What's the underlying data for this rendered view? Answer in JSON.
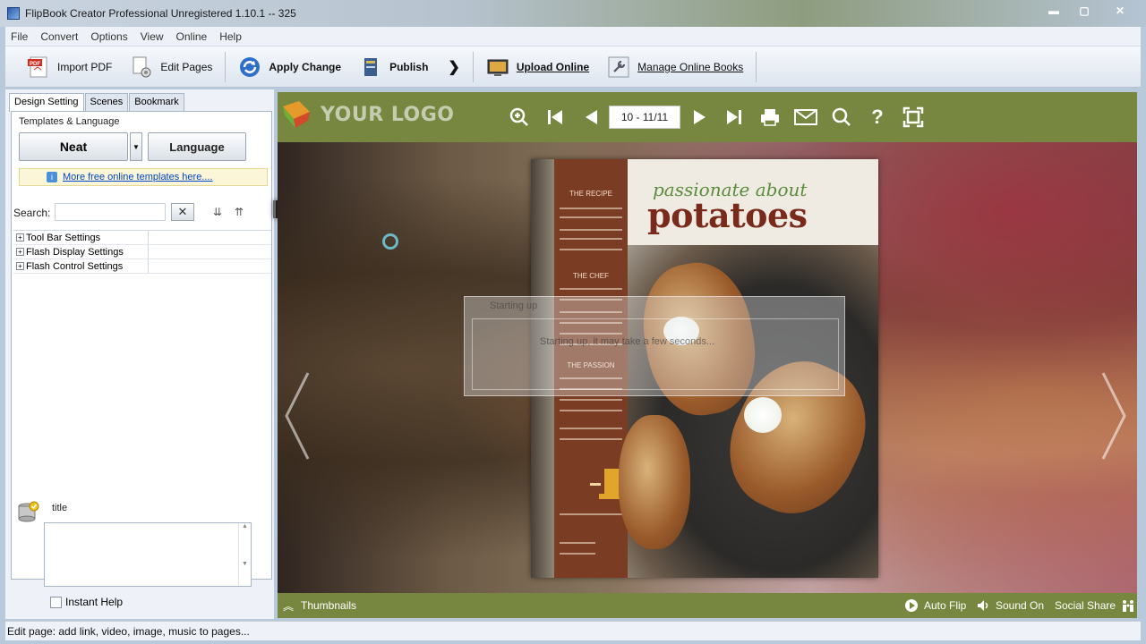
{
  "window": {
    "title": "FlipBook Creator Professional Unregistered 1.10.1  -- 325",
    "minimize": "▬",
    "maximize": "▢",
    "close": "✕"
  },
  "menu": [
    "File",
    "Convert",
    "Options",
    "View",
    "Online",
    "Help"
  ],
  "toolbar": {
    "import_pdf": "Import PDF",
    "edit_pages": "Edit Pages",
    "apply_change": "Apply Change",
    "publish": "Publish",
    "upload_online": "Upload Online",
    "manage_online_books": "Manage Online Books"
  },
  "left_panel": {
    "tabs": [
      "Design Setting",
      "Scenes",
      "Bookmark"
    ],
    "templates_label": "Templates & Language",
    "template_button": "Neat",
    "language_button": "Language",
    "more_templates_link": "More free online templates here....",
    "search_label": "Search:",
    "search_value": "",
    "tree": [
      "Tool Bar Settings",
      "Flash Display Settings",
      "Flash Control Settings"
    ],
    "prop_title": "title",
    "instant_help": "Instant Help"
  },
  "viewer": {
    "logo_text": "YOUR LOGO",
    "page_field": "10 - 11/11",
    "book_script": "passionate about",
    "book_title": "potatoes",
    "book_sidebar": [
      "THE RECIPE",
      "THE CHEF",
      "THE PASSION"
    ],
    "dialog_title": "Starting up",
    "dialog_message": "Starting up, it may take a few seconds...",
    "bottom": {
      "thumbnails": "Thumbnails",
      "auto_flip": "Auto Flip",
      "sound_on": "Sound On",
      "social_share": "Social Share"
    },
    "colors": {
      "bar": "#77873f"
    }
  },
  "status_bar": "Edit page: add link, video, image, music to pages..."
}
